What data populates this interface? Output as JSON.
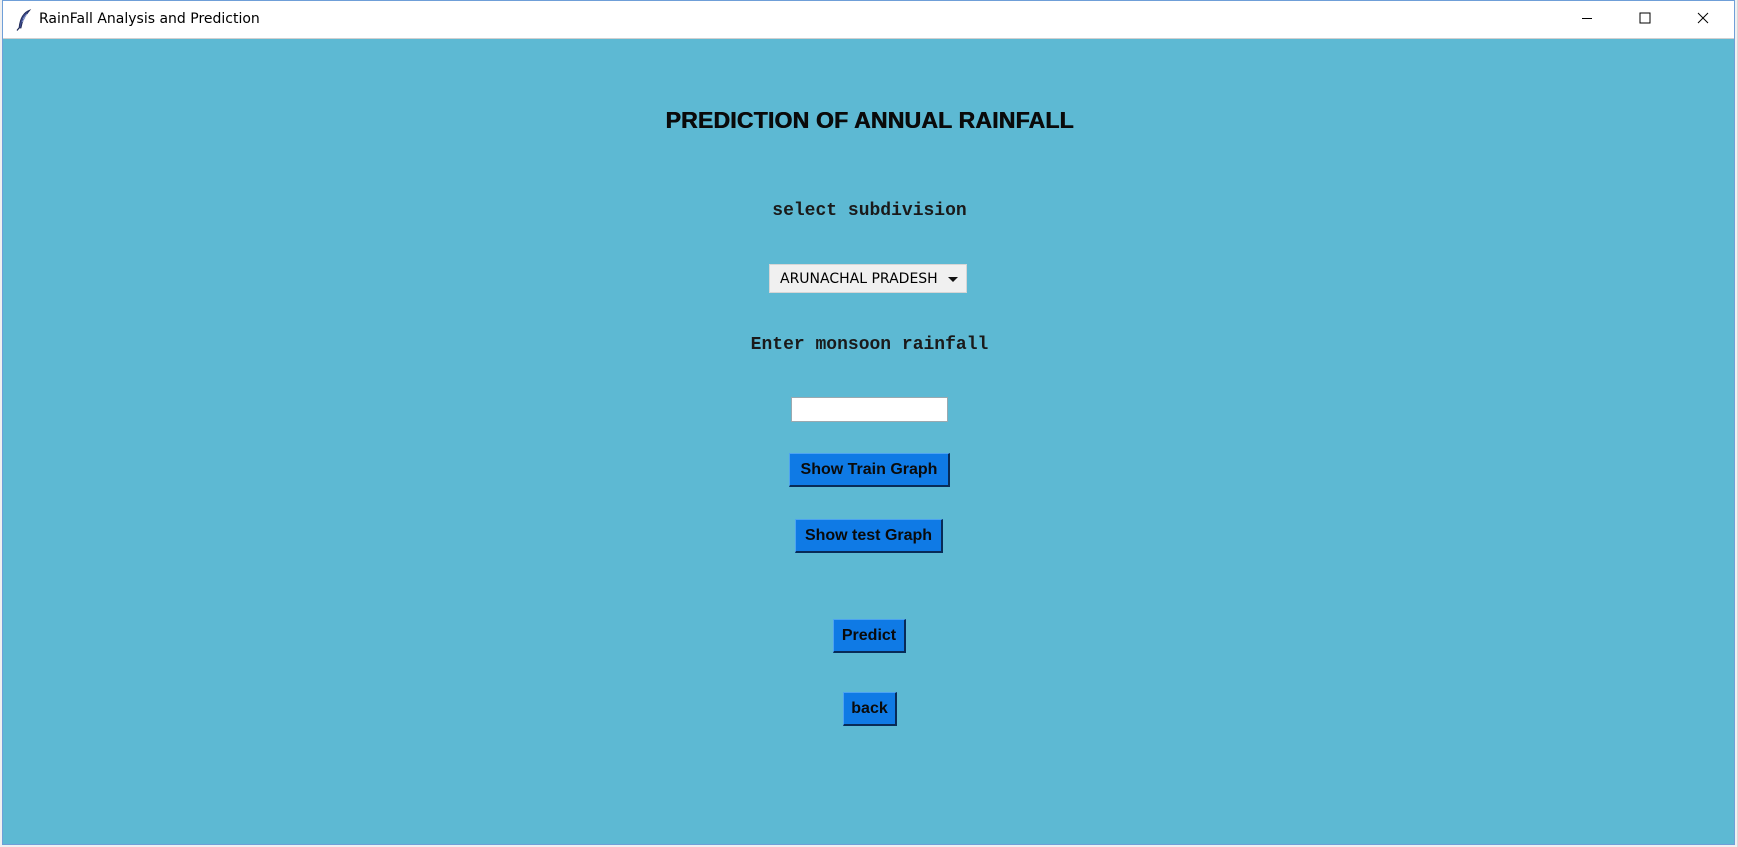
{
  "window": {
    "title": "RainFall Analysis and Prediction",
    "app_icon": "feather-icon",
    "controls": [
      "minimize-icon",
      "maximize-icon",
      "close-icon"
    ]
  },
  "main": {
    "heading": "PREDICTION OF ANNUAL RAINFALL",
    "subdivision_label": "select subdivision",
    "subdivision_selected": "ARUNACHAL PRADESH",
    "monsoon_label": "Enter monsoon rainfall",
    "monsoon_value": "",
    "train_graph_button": "Show Train Graph",
    "test_graph_button": "Show test Graph",
    "predict_button": "Predict",
    "back_button": "back"
  },
  "colors": {
    "background": "#5db9d3",
    "button": "#0f7ae5"
  }
}
